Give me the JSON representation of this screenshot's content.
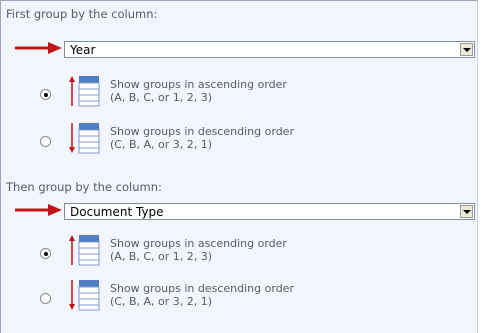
{
  "first_group": {
    "heading": "First group by the column:",
    "selected_value": "Year",
    "options": [
      {
        "line1": "Show groups in ascending order",
        "line2": "(A, B, C, or 1, 2, 3)",
        "checked": true
      },
      {
        "line1": "Show groups in descending order",
        "line2": "(C, B, A, or 3, 2, 1)",
        "checked": false
      }
    ]
  },
  "then_group": {
    "heading": "Then group by the column:",
    "selected_value": "Document Type",
    "options": [
      {
        "line1": "Show groups in ascending order",
        "line2": "(A, B, C, or 1, 2, 3)",
        "checked": true
      },
      {
        "line1": "Show groups in descending order",
        "line2": "(C, B, A, or 3, 2, 1)",
        "checked": false
      }
    ]
  },
  "icons": {
    "pointer_arrow": "red-pointer-arrow-icon",
    "ascending": "sort-ascending-icon",
    "descending": "sort-descending-icon",
    "dropdown": "chevron-down-icon"
  },
  "colors": {
    "arrow": "#c0141b",
    "panel_bg": "#f2f5fb",
    "label_text": "#555d68",
    "icon_blue": "#4f7fc2"
  }
}
